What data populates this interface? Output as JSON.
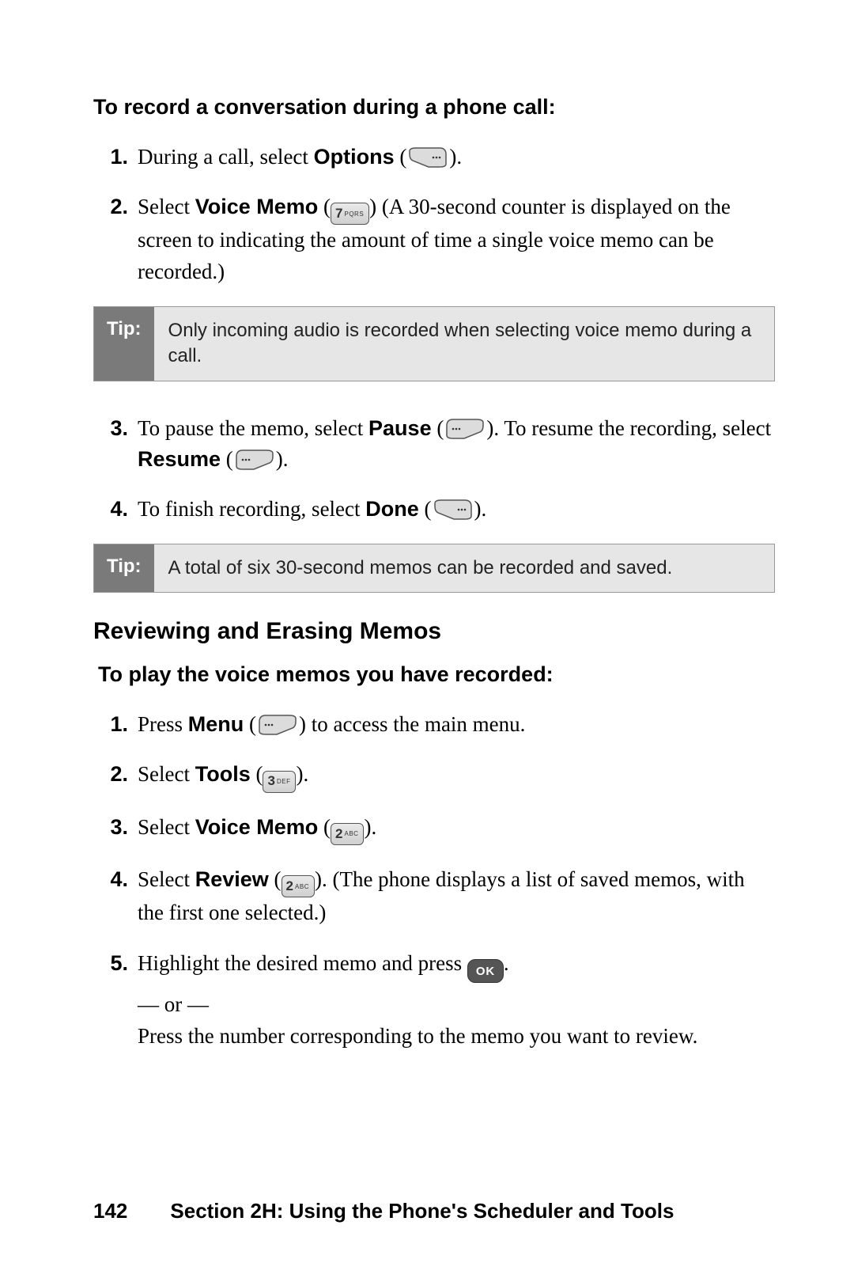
{
  "intro1": "To record a conversation during a phone call:",
  "steps1": {
    "s1_pre": "During a call, select ",
    "s1_bold": "Options",
    "s1_post": " (",
    "s1_close": ").",
    "s2_pre": "Select ",
    "s2_bold": "Voice Memo",
    "s2_post": " (",
    "s2_after": ") (A 30-second counter is displayed on the screen to indicating the amount of time a single voice memo can be recorded.)",
    "s3_pre": "To pause the memo, select ",
    "s3_bold1": "Pause",
    "s3_mid1": " (",
    "s3_mid2": "). To resume the recording, select ",
    "s3_bold2": "Resume",
    "s3_mid3": " (",
    "s3_end": ").",
    "s4_pre": "To finish recording, select ",
    "s4_bold": "Done",
    "s4_post": " (",
    "s4_end": ")."
  },
  "tip_label": "Tip:",
  "tip1": "Only incoming audio is recorded when selecting voice memo during a call.",
  "tip2": "A total of six 30-second memos can be recorded and saved.",
  "subheading": "Reviewing and Erasing Memos",
  "intro2": "To play the voice memos you have recorded:",
  "steps2": {
    "s1_pre": "Press ",
    "s1_bold": "Menu",
    "s1_post": " (",
    "s1_after": ") to access the main menu.",
    "s2_pre": "Select ",
    "s2_bold": "Tools",
    "s2_post": " (",
    "s2_end": ").",
    "s3_pre": "Select ",
    "s3_bold": "Voice Memo",
    "s3_post": " (",
    "s3_end": ").",
    "s4_pre": "Select ",
    "s4_bold": "Review",
    "s4_post": " (",
    "s4_after": "). (The phone displays a list of saved memos, with the first one selected.)",
    "s5_pre": "Highlight the desired memo and press ",
    "s5_post": ".",
    "s5_or": "— or —",
    "s5_alt": "Press the number corresponding to the memo you want to review."
  },
  "keys": {
    "k7_big": "7",
    "k7_small": "PQRS",
    "k3_big": "3",
    "k3_small": "DEF",
    "k2_big": "2",
    "k2_small": "ABC",
    "ok": "OK"
  },
  "nums": {
    "n1": "1.",
    "n2": "2.",
    "n3": "3.",
    "n4": "4.",
    "n5": "5."
  },
  "footer": {
    "page": "142",
    "section": "Section 2H: Using the Phone's Scheduler and Tools"
  }
}
